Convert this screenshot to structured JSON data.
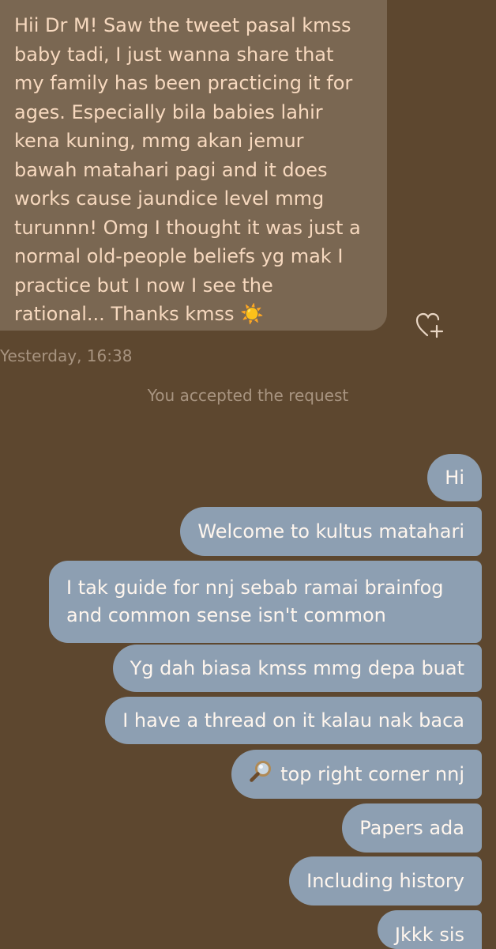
{
  "incoming_message": {
    "lines": [
      "Hii Dr M! Saw the tweet pasal kmss",
      "baby tadi, I just wanna share that",
      "my family has been practicing it for",
      "ages. Especially bila babies lahir",
      "kena kuning, mmg akan jemur",
      "bawah matahari pagi and it does",
      "works cause jaundice level mmg",
      "turunnn! Omg I thought it was just a",
      "normal old-people beliefs yg mak I",
      "practice but I now I see the",
      "rational... Thanks kmss ☀️"
    ],
    "timestamp": "Yesterday, 16:38"
  },
  "system_message": "You accepted the request",
  "outgoing_messages": [
    "Hi",
    "Welcome to kultus matahari",
    "I tak guide for nnj sebab ramai brainfog",
    "and common sense isn't common",
    "Yg dah biasa kmss mmg depa buat",
    "I have a thread on it kalau nak baca",
    "top right corner nnj",
    "Papers ada",
    "Including history",
    "Jkkk sis"
  ],
  "icons": {
    "react": "heart-plus-icon",
    "magnifier": "magnifying-glass-icon"
  },
  "colors": {
    "background": "#5d472f",
    "incoming_bubble": "#7a6752",
    "incoming_text": "#f7d9bf",
    "outgoing_bubble": "#8d9fb2",
    "outgoing_text": "#fff6ee",
    "meta_text": "#a89480"
  }
}
